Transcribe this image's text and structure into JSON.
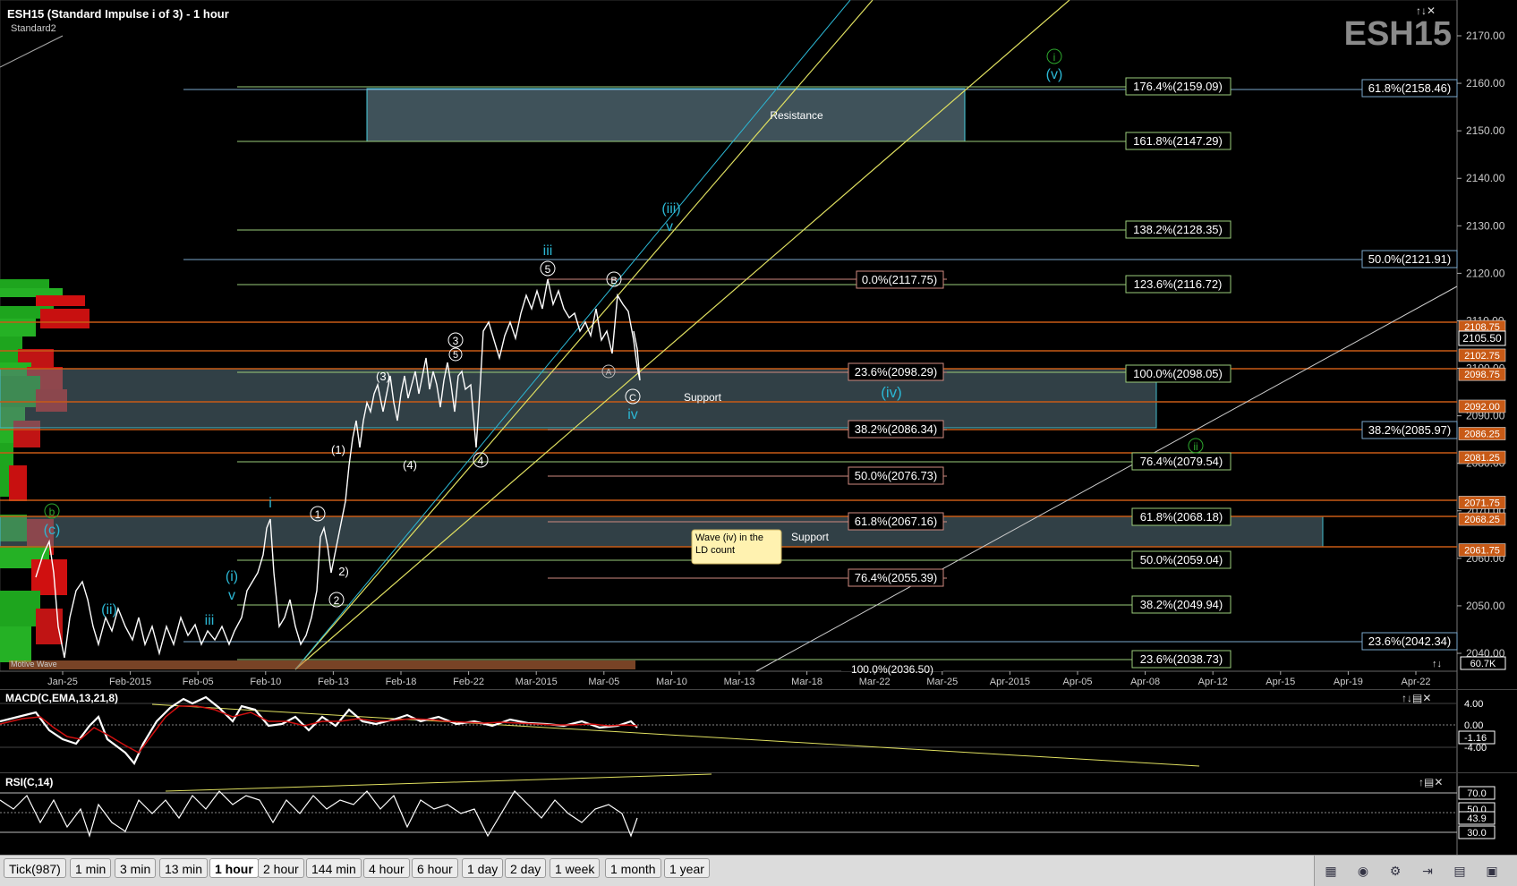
{
  "header": {
    "title": "ESH15 (Standard Impulse i of 3) - 1 hour",
    "template": "Standard2",
    "symbol_watermark": "ESH15",
    "corner_controls": "↑↓✕"
  },
  "price_axis": {
    "ticks": [
      "2170.00",
      "2160.00",
      "2150.00",
      "2140.00",
      "2130.00",
      "2120.00",
      "2110.00",
      "2100.00",
      "2090.00",
      "2080.00",
      "2070.00",
      "2060.00",
      "2050.00",
      "2040.00"
    ],
    "current_price": "2105.50",
    "level_tags": [
      "2108.75",
      "2102.75",
      "2098.75",
      "2092.00",
      "2086.25",
      "2081.25",
      "2071.75",
      "2068.25",
      "2061.75"
    ],
    "volume_tag": "60.7K",
    "colors": {
      "orange": "#c85a16",
      "tag_border": "#e0e0e0"
    }
  },
  "time_axis": {
    "labels": [
      "Jan-25",
      "Feb-2015",
      "Feb-05",
      "Feb-10",
      "Feb-13",
      "Feb-18",
      "Feb-22",
      "Mar-2015",
      "Mar-05",
      "Mar-10",
      "Mar-13",
      "Mar-18",
      "Mar-22",
      "Mar-25",
      "Apr-2015",
      "Apr-05",
      "Apr-08",
      "Apr-12",
      "Apr-15",
      "Apr-19",
      "Apr-22"
    ]
  },
  "fib_labels": {
    "right_top": "61.8%(2158.46)",
    "r_1764": "176.4%(2159.09)",
    "r_1618": "161.8%(2147.29)",
    "r_1382": "138.2%(2128.35)",
    "right_50": "50.0%(2121.91)",
    "r_1236": "123.6%(2116.72)",
    "m_0": "0.0%(2117.75)",
    "m_236": "23.6%(2098.29)",
    "r_100": "100.0%(2098.05)",
    "m_382": "38.2%(2086.34)",
    "right_382": "38.2%(2085.97)",
    "r_764": "76.4%(2079.54)",
    "m_50": "50.0%(2076.73)",
    "m_618": "61.8%(2067.16)",
    "r_618": "61.8%(2068.18)",
    "r_50": "50.0%(2059.04)",
    "m_764": "76.4%(2055.39)",
    "r_382": "38.2%(2049.94)",
    "right_236": "23.6%(2042.34)",
    "r_236": "23.6%(2038.73)",
    "m_100": "100.0%(2036.50)"
  },
  "zones": {
    "resistance": "Resistance",
    "support1": "Support",
    "support2": "Support",
    "note": "Wave (iv) in the LD count"
  },
  "wave_labels": {
    "green_i": "i",
    "v_top": "(v)",
    "iii_paren": "(iii)",
    "v_small": "v",
    "iii_top": "iii",
    "five_circle": "5",
    "b_circle": "B",
    "a_circle": "A",
    "c_circle": "C",
    "iv": "iv",
    "iv_paren": "(iv)",
    "three_circle": "3",
    "five_circle2": "5",
    "three_paren": "(3)",
    "one_paren": "(1)",
    "four_paren": "(4)",
    "four_circle": "4",
    "green_ii": "ii",
    "green_b": "b",
    "c_paren": "(c)",
    "i_small": "i",
    "one_circle": "1",
    "two_paren": "2)",
    "two_circle": "2",
    "i_paren": "(i)",
    "v_small2": "v",
    "ii_paren": "(ii)",
    "iii_small": "iii",
    "motive_wave": "Motive Wave"
  },
  "macd": {
    "title": "MACD(C,EMA,13,21,8)",
    "ticks": [
      "4.00",
      "0.00",
      "-1.16",
      "-4.00"
    ]
  },
  "rsi": {
    "title": "RSI(C,14)",
    "ticks": [
      "70.0",
      "50.0",
      "43.9",
      "30.0"
    ]
  },
  "tabs": [
    "Tick(987)",
    "1 min",
    "3 min",
    "13 min",
    "1 hour",
    "2 hour",
    "144 min",
    "4 hour",
    "6 hour",
    "1 day",
    "2 day",
    "1 week",
    "1 month",
    "1 year"
  ],
  "active_tab": "1 hour",
  "tools": [
    "chart-type-icon",
    "eye-icon",
    "template-icon",
    "scroll-end-icon",
    "calendar-icon",
    "layout-icon"
  ]
}
